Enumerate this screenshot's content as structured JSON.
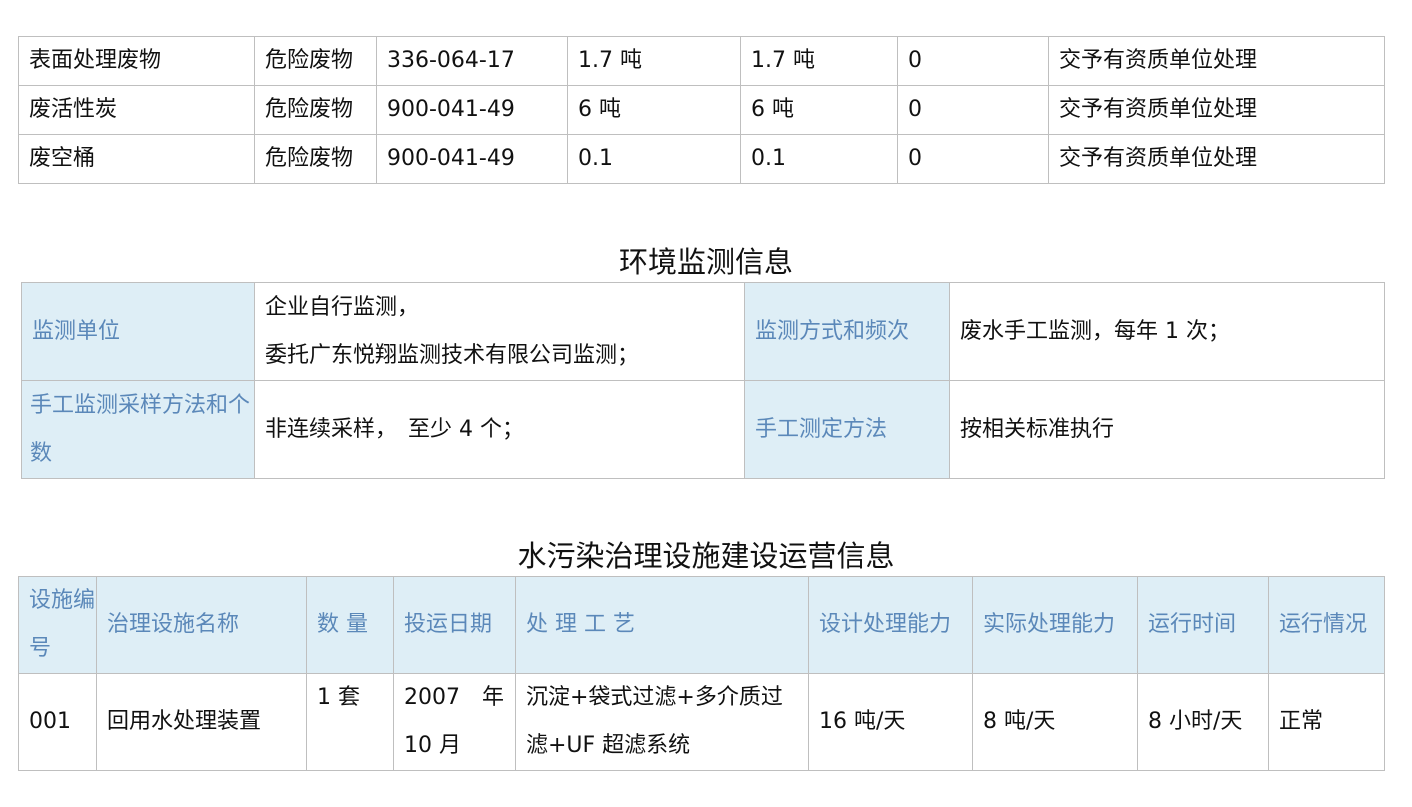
{
  "waste_table": {
    "rows": [
      [
        "表面处理废物",
        "危险废物",
        "336-064-17",
        "1.7 吨",
        "1.7 吨",
        "0",
        "交予有资质单位处理"
      ],
      [
        "废活性炭",
        "危险废物",
        "900-041-49",
        "6 吨",
        "6 吨",
        "0",
        "交予有资质单位处理"
      ],
      [
        "废空桶",
        "危险废物",
        "900-041-49",
        "0.1",
        "0.1",
        "0",
        "交予有资质单位处理"
      ]
    ]
  },
  "monitoring": {
    "title": "环境监测信息",
    "unit_label": "监测单位",
    "unit_value_line1": "企业自行监测，",
    "unit_value_line2": "委托广东悦翔监测技术有限公司监测；",
    "method_freq_label": "监测方式和频次",
    "method_freq_value": "废水手工监测，每年 1 次；",
    "sampling_label": "手工监测采样方法和个数",
    "sampling_value": "非连续采样，　至少 4 个；",
    "measure_label": "手工测定方法",
    "measure_value": "按相关标准执行"
  },
  "facility": {
    "title": "水污染治理设施建设运营信息",
    "headers": [
      "设施编号",
      "治理设施名称",
      "数 量",
      "投运日期",
      "处 理 工 艺",
      "设计处理能力",
      "实际处理能力",
      "运行时间",
      "运行情况"
    ],
    "row": {
      "id": "001",
      "name": "回用水处理装置",
      "quantity": "1 套",
      "date_line1": "2007　年",
      "date_line2": "10 月",
      "process_line1": "沉淀+袋式过滤+多介质过",
      "process_line2": "滤+UF 超滤系统",
      "design_capacity": "16 吨/天",
      "actual_capacity": "8 吨/天",
      "run_time": "8 小时/天",
      "status": "正常"
    }
  }
}
